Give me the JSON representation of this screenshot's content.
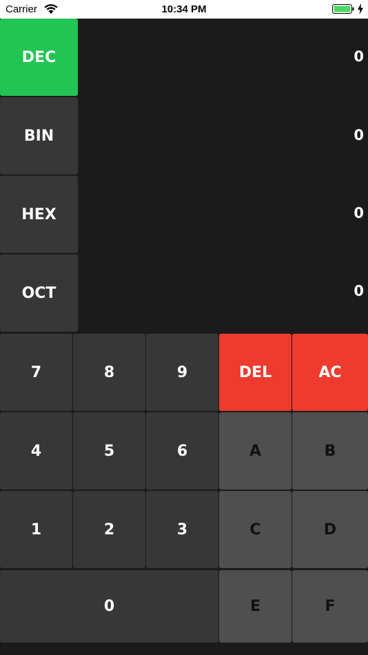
{
  "status_bar": {
    "carrier": "Carrier",
    "time": "10:34 PM",
    "wifi_icon": "wifi-icon",
    "battery_icon": "battery-icon",
    "charging_icon": "charging-bolt-icon",
    "battery_color": "#4cd964"
  },
  "bases": [
    {
      "label": "DEC",
      "value": "0",
      "active": true
    },
    {
      "label": "BIN",
      "value": "0",
      "active": false
    },
    {
      "label": "HEX",
      "value": "0",
      "active": false
    },
    {
      "label": "OCT",
      "value": "0",
      "active": false
    }
  ],
  "keypad": {
    "row1": [
      "7",
      "8",
      "9",
      "DEL",
      "AC"
    ],
    "row2": [
      "4",
      "5",
      "6",
      "A",
      "B"
    ],
    "row3": [
      "1",
      "2",
      "3",
      "C",
      "D"
    ],
    "row4": [
      "0",
      "E",
      "F"
    ]
  },
  "colors": {
    "background": "#1b1b1b",
    "active_base": "#22c553",
    "number_key": "#373737",
    "hex_key": "#4f4f4f",
    "action_key": "#ee3b2f"
  }
}
